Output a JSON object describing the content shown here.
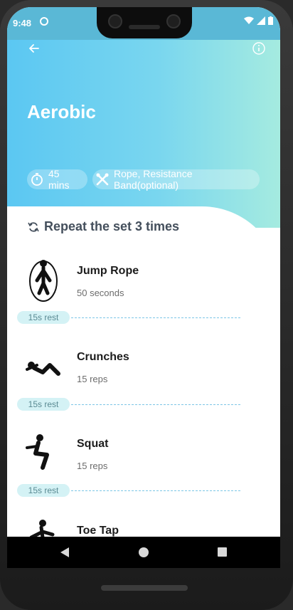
{
  "status_bar": {
    "time": "9:48"
  },
  "header": {
    "title": "Aerobic",
    "duration": "45 mins",
    "equipment": "Rope, Resistance Band(optional)"
  },
  "workout": {
    "repeat_text": "Repeat the set 3 times",
    "exercises": [
      {
        "name": "Jump Rope",
        "detail": "50 seconds",
        "icon": "jump-rope-icon"
      },
      {
        "name": "Crunches",
        "detail": "15 reps",
        "icon": "crunches-icon"
      },
      {
        "name": "Squat",
        "detail": "15 reps",
        "icon": "squat-icon"
      },
      {
        "name": "Toe Tap",
        "detail": "",
        "icon": "toe-tap-icon"
      }
    ],
    "rests": [
      "15s rest",
      "15s rest",
      "15s rest"
    ]
  },
  "colors": {
    "hero_gradient_start": "#5bc7f2",
    "hero_gradient_end": "#a5ebe0",
    "rest_badge": "#d4f2f5",
    "rest_line": "#7cc6e6"
  }
}
